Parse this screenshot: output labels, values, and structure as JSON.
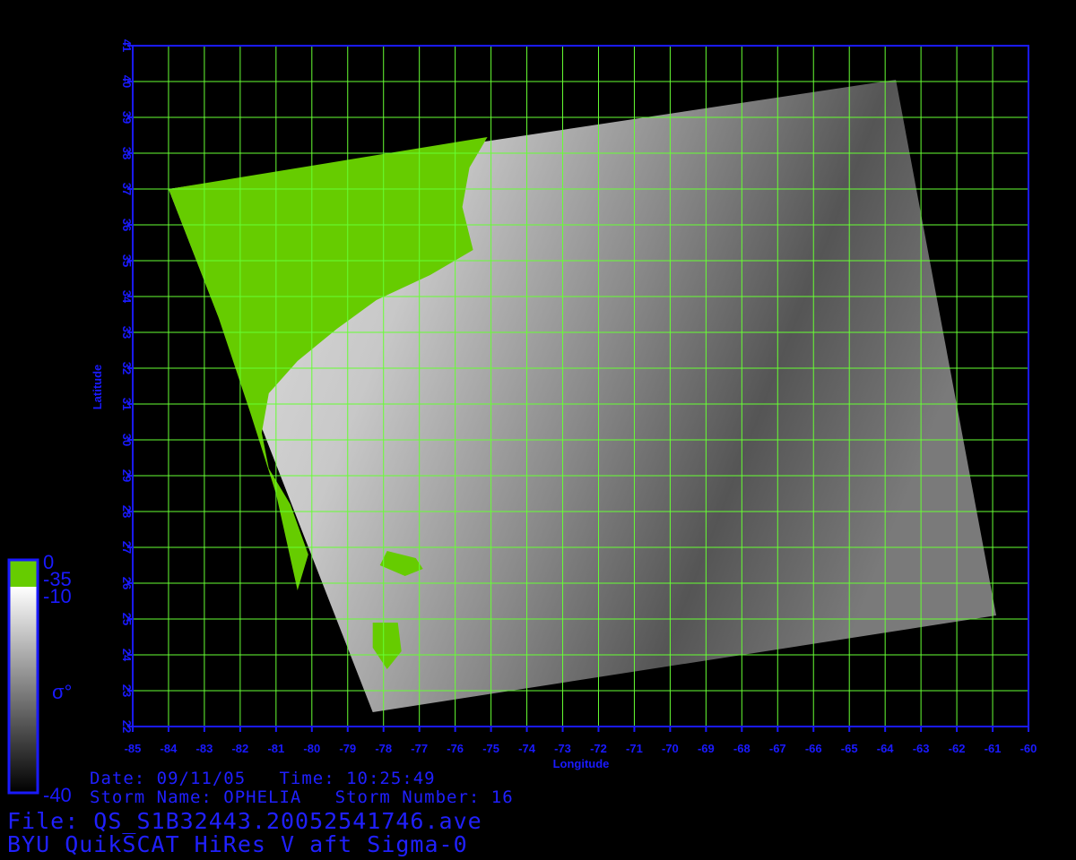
{
  "axes": {
    "x_label": "Longitude",
    "y_label": "Latitude",
    "x_ticks": [
      "-85",
      "-84",
      "-83",
      "-82",
      "-81",
      "-80",
      "-79",
      "-78",
      "-77",
      "-76",
      "-75",
      "-74",
      "-73",
      "-72",
      "-71",
      "-70",
      "-69",
      "-68",
      "-67",
      "-66",
      "-65",
      "-64",
      "-63",
      "-62",
      "-61",
      "-60"
    ],
    "y_ticks": [
      "22",
      "23",
      "24",
      "25",
      "26",
      "27",
      "28",
      "29",
      "30",
      "31",
      "32",
      "33",
      "34",
      "35",
      "36",
      "37",
      "38",
      "39",
      "40",
      "41"
    ],
    "x_range": [
      -85,
      -60
    ],
    "y_range": [
      22,
      41
    ]
  },
  "swath_corners_lonlat": [
    [
      -84,
      37
    ],
    [
      -63.7,
      40.05
    ],
    [
      -60.9,
      25.1
    ],
    [
      -78.3,
      22.4
    ]
  ],
  "colorbar": {
    "land_top": "0",
    "land_bottom": "-35",
    "sigma_top": "-10",
    "sigma_bottom": "-40",
    "symbol": "σ°",
    "land_color": "#66cc00",
    "grid_color": "#66ff33",
    "axis_color": "#1a1aff"
  },
  "info": {
    "line1": "Date: 09/11/05   Time: 10:25:49",
    "line2": "Storm Name: OPHELIA   Storm Number: 16",
    "file": "File: QS_S1B32443.20052541746.ave",
    "product": "BYU QuikSCAT HiRes V aft Sigma-0"
  }
}
